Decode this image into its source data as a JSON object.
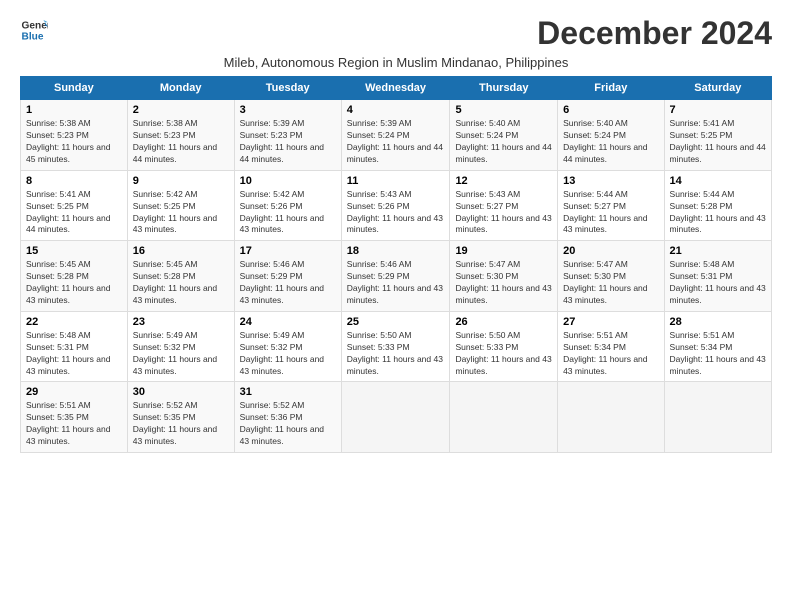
{
  "logo": {
    "line1": "General",
    "line2": "Blue"
  },
  "title": "December 2024",
  "subtitle": "Mileb, Autonomous Region in Muslim Mindanao, Philippines",
  "days_of_week": [
    "Sunday",
    "Monday",
    "Tuesday",
    "Wednesday",
    "Thursday",
    "Friday",
    "Saturday"
  ],
  "weeks": [
    [
      {
        "day": 1,
        "sunrise": "5:38 AM",
        "sunset": "5:23 PM",
        "daylight": "11 hours and 45 minutes."
      },
      {
        "day": 2,
        "sunrise": "5:38 AM",
        "sunset": "5:23 PM",
        "daylight": "11 hours and 44 minutes."
      },
      {
        "day": 3,
        "sunrise": "5:39 AM",
        "sunset": "5:23 PM",
        "daylight": "11 hours and 44 minutes."
      },
      {
        "day": 4,
        "sunrise": "5:39 AM",
        "sunset": "5:24 PM",
        "daylight": "11 hours and 44 minutes."
      },
      {
        "day": 5,
        "sunrise": "5:40 AM",
        "sunset": "5:24 PM",
        "daylight": "11 hours and 44 minutes."
      },
      {
        "day": 6,
        "sunrise": "5:40 AM",
        "sunset": "5:24 PM",
        "daylight": "11 hours and 44 minutes."
      },
      {
        "day": 7,
        "sunrise": "5:41 AM",
        "sunset": "5:25 PM",
        "daylight": "11 hours and 44 minutes."
      }
    ],
    [
      {
        "day": 8,
        "sunrise": "5:41 AM",
        "sunset": "5:25 PM",
        "daylight": "11 hours and 44 minutes."
      },
      {
        "day": 9,
        "sunrise": "5:42 AM",
        "sunset": "5:25 PM",
        "daylight": "11 hours and 43 minutes."
      },
      {
        "day": 10,
        "sunrise": "5:42 AM",
        "sunset": "5:26 PM",
        "daylight": "11 hours and 43 minutes."
      },
      {
        "day": 11,
        "sunrise": "5:43 AM",
        "sunset": "5:26 PM",
        "daylight": "11 hours and 43 minutes."
      },
      {
        "day": 12,
        "sunrise": "5:43 AM",
        "sunset": "5:27 PM",
        "daylight": "11 hours and 43 minutes."
      },
      {
        "day": 13,
        "sunrise": "5:44 AM",
        "sunset": "5:27 PM",
        "daylight": "11 hours and 43 minutes."
      },
      {
        "day": 14,
        "sunrise": "5:44 AM",
        "sunset": "5:28 PM",
        "daylight": "11 hours and 43 minutes."
      }
    ],
    [
      {
        "day": 15,
        "sunrise": "5:45 AM",
        "sunset": "5:28 PM",
        "daylight": "11 hours and 43 minutes."
      },
      {
        "day": 16,
        "sunrise": "5:45 AM",
        "sunset": "5:28 PM",
        "daylight": "11 hours and 43 minutes."
      },
      {
        "day": 17,
        "sunrise": "5:46 AM",
        "sunset": "5:29 PM",
        "daylight": "11 hours and 43 minutes."
      },
      {
        "day": 18,
        "sunrise": "5:46 AM",
        "sunset": "5:29 PM",
        "daylight": "11 hours and 43 minutes."
      },
      {
        "day": 19,
        "sunrise": "5:47 AM",
        "sunset": "5:30 PM",
        "daylight": "11 hours and 43 minutes."
      },
      {
        "day": 20,
        "sunrise": "5:47 AM",
        "sunset": "5:30 PM",
        "daylight": "11 hours and 43 minutes."
      },
      {
        "day": 21,
        "sunrise": "5:48 AM",
        "sunset": "5:31 PM",
        "daylight": "11 hours and 43 minutes."
      }
    ],
    [
      {
        "day": 22,
        "sunrise": "5:48 AM",
        "sunset": "5:31 PM",
        "daylight": "11 hours and 43 minutes."
      },
      {
        "day": 23,
        "sunrise": "5:49 AM",
        "sunset": "5:32 PM",
        "daylight": "11 hours and 43 minutes."
      },
      {
        "day": 24,
        "sunrise": "5:49 AM",
        "sunset": "5:32 PM",
        "daylight": "11 hours and 43 minutes."
      },
      {
        "day": 25,
        "sunrise": "5:50 AM",
        "sunset": "5:33 PM",
        "daylight": "11 hours and 43 minutes."
      },
      {
        "day": 26,
        "sunrise": "5:50 AM",
        "sunset": "5:33 PM",
        "daylight": "11 hours and 43 minutes."
      },
      {
        "day": 27,
        "sunrise": "5:51 AM",
        "sunset": "5:34 PM",
        "daylight": "11 hours and 43 minutes."
      },
      {
        "day": 28,
        "sunrise": "5:51 AM",
        "sunset": "5:34 PM",
        "daylight": "11 hours and 43 minutes."
      }
    ],
    [
      {
        "day": 29,
        "sunrise": "5:51 AM",
        "sunset": "5:35 PM",
        "daylight": "11 hours and 43 minutes."
      },
      {
        "day": 30,
        "sunrise": "5:52 AM",
        "sunset": "5:35 PM",
        "daylight": "11 hours and 43 minutes."
      },
      {
        "day": 31,
        "sunrise": "5:52 AM",
        "sunset": "5:36 PM",
        "daylight": "11 hours and 43 minutes."
      },
      null,
      null,
      null,
      null
    ]
  ]
}
